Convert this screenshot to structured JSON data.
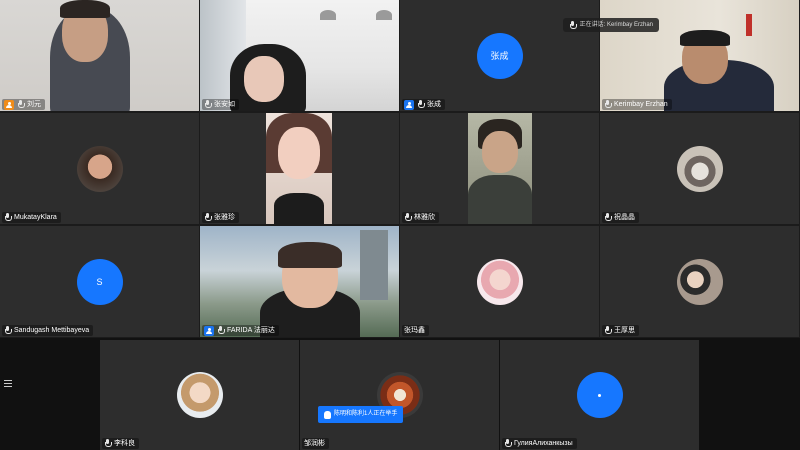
{
  "tiles": [
    {
      "name": "刘元",
      "badge": "orange"
    },
    {
      "name": "张安如",
      "badge": "none"
    },
    {
      "name": "张成",
      "badge": "blue",
      "avatar_text": "张成"
    },
    {
      "name": "Kerimbay Erzhan",
      "badge": "none"
    },
    {
      "name": "MukatayKlara",
      "badge": "none"
    },
    {
      "name": "张雅珍",
      "badge": "none"
    },
    {
      "name": "林雅欣",
      "badge": "none"
    },
    {
      "name": "祝晶晶",
      "badge": "none"
    },
    {
      "name": "Sandugash Mettibayeva",
      "badge": "none",
      "avatar_text": "S"
    },
    {
      "name": "FARIDA 法丽达",
      "badge": "blue"
    },
    {
      "name": "张玛鑫",
      "badge": "none"
    },
    {
      "name": "王厚思",
      "badge": "none"
    },
    {
      "name": "李科良",
      "badge": "none"
    },
    {
      "name": "邹润彬",
      "badge": "none"
    },
    {
      "name": "ГулияАлиханкызы",
      "badge": "none"
    }
  ],
  "speaking": {
    "label": "正在讲话: Kerimbay Erzhan"
  },
  "raise_hand": {
    "label": "陈明和陈利1人正在举手"
  },
  "colors": {
    "accent": "#1677ff",
    "tile_bg": "#2d2d2d",
    "host": "#f08c1a"
  }
}
